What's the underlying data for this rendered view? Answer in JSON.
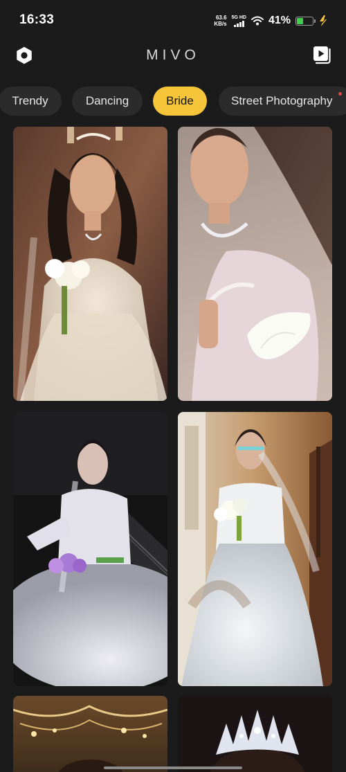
{
  "status_bar": {
    "time": "16:33",
    "net_speed_value": "63.6",
    "net_speed_unit": "KB/s",
    "network_label": "5G HD",
    "battery_percent": "41%",
    "battery_level": 0.41,
    "battery_color": "#3ecf4c"
  },
  "header": {
    "title": "MIVO",
    "left_icon": "settings-hexagon-icon",
    "right_icon": "video-library-icon"
  },
  "tabs": [
    {
      "label": "Trendy",
      "active": false
    },
    {
      "label": "Dancing",
      "active": false
    },
    {
      "label": "Bride",
      "active": true
    },
    {
      "label": "Street Photography",
      "active": false,
      "has_badge": true
    }
  ],
  "accent_color": "#f7c53a",
  "gallery": {
    "items": [
      {
        "name": "bride-photo-1",
        "theme": "bride with bouquet, warm background"
      },
      {
        "name": "bride-photo-2",
        "theme": "bride with veil and calla lilies"
      },
      {
        "name": "bride-photo-3",
        "theme": "bride with purple bouquet on stairs"
      },
      {
        "name": "bride-photo-4",
        "theme": "bride with white bouquet in hallway"
      },
      {
        "name": "bride-photo-5",
        "theme": "chandelier scene"
      },
      {
        "name": "bride-photo-6",
        "theme": "bride with crystal crown"
      }
    ]
  }
}
